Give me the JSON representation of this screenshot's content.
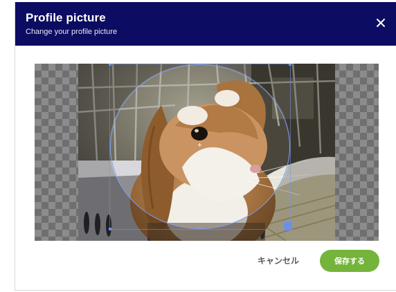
{
  "dialog": {
    "title": "Profile picture",
    "subtitle": "Change your profile picture",
    "close_icon": "close-icon",
    "header_color": "#0c0c62"
  },
  "cropper": {
    "photo_subject": "rabbit",
    "crop_shape": "circle",
    "accent_color": "#6d8fe8"
  },
  "actions": {
    "cancel_label": "キャンセル",
    "save_label": "保存する",
    "save_color": "#74b43b"
  }
}
